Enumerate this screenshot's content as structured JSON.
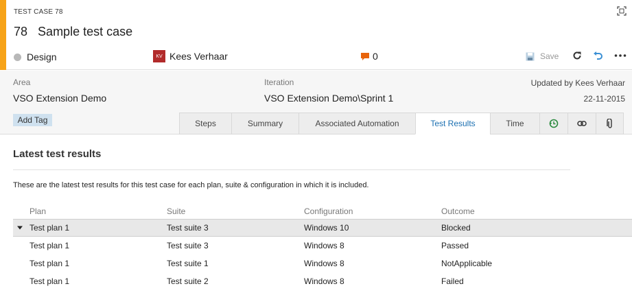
{
  "work_item": {
    "type_label": "TEST CASE 78",
    "id": "78",
    "title": "Sample test case",
    "state": "Design",
    "assignee_initials": "KV",
    "assignee": "Kees Verhaar",
    "comment_count": "0",
    "save_label": "Save",
    "accent_color": "#f7a318"
  },
  "fields": {
    "area_label": "Area",
    "area_value": "VSO Extension Demo",
    "iteration_label": "Iteration",
    "iteration_value": "VSO Extension Demo\\Sprint 1",
    "updated_by": "Updated by Kees Verhaar",
    "updated_date": "22-11-2015",
    "add_tag_label": "Add Tag"
  },
  "tabs": [
    {
      "label": "Steps"
    },
    {
      "label": "Summary"
    },
    {
      "label": "Associated Automation"
    },
    {
      "label": "Test Results",
      "active": true
    },
    {
      "label": "Time"
    },
    {
      "icon": "history-icon"
    },
    {
      "icon": "link-icon"
    },
    {
      "icon": "attachment-icon"
    }
  ],
  "content": {
    "title": "Latest test results",
    "description": "These are the latest test results for this test case for each plan, suite & configuration in which it is included."
  },
  "results": {
    "columns": [
      "Plan",
      "Suite",
      "Configuration",
      "Outcome"
    ],
    "rows": [
      [
        "Test plan 1",
        "Test suite 3",
        "Windows 10",
        "Blocked"
      ],
      [
        "Test plan 1",
        "Test suite 3",
        "Windows 8",
        "Passed"
      ],
      [
        "Test plan 1",
        "Test suite 1",
        "Windows 8",
        "NotApplicable"
      ],
      [
        "Test plan 1",
        "Test suite 2",
        "Windows 8",
        "Failed"
      ]
    ],
    "selected_row": 0
  }
}
